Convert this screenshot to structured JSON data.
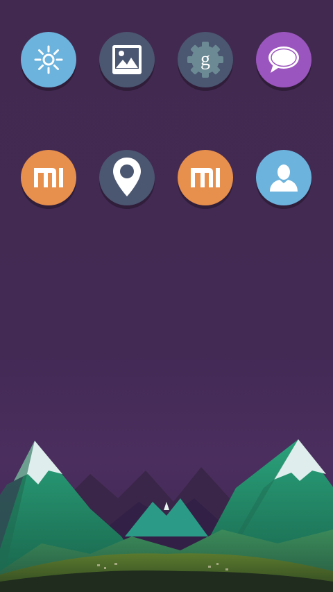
{
  "screen": "home",
  "background_color": "#432a55",
  "apps": [
    {
      "icon": "sun-icon",
      "color": "#6cb3dd"
    },
    {
      "icon": "gallery-icon",
      "color": "#4b5670"
    },
    {
      "icon": "google-settings-icon",
      "color": "#4b5670"
    },
    {
      "icon": "chat-bubble-icon",
      "color": "#9b55be"
    },
    {
      "icon": "mi-icon",
      "color": "#e78f4c",
      "text": "mi"
    },
    {
      "icon": "map-pin-icon",
      "color": "#4b5670"
    },
    {
      "icon": "mi-icon",
      "color": "#e78f4c",
      "text": "mi"
    },
    {
      "icon": "contact-icon",
      "color": "#6cb3dd"
    }
  ],
  "google_letter": "g"
}
